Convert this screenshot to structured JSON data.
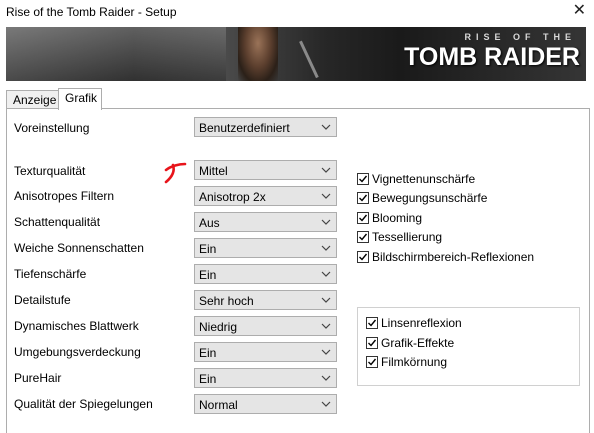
{
  "window": {
    "title": "Rise of the Tomb Raider - Setup",
    "close_glyph": "✕"
  },
  "banner": {
    "logo_line1": "RISE OF THE",
    "logo_line2": "TOMB RAIDER"
  },
  "tabs": [
    {
      "label": "Anzeige",
      "selected": false
    },
    {
      "label": "Grafik",
      "selected": true
    }
  ],
  "preset": {
    "label": "Voreinstellung",
    "value": "Benutzerdefiniert"
  },
  "settings": [
    {
      "label": "Texturqualität",
      "value": "Mittel"
    },
    {
      "label": "Anisotropes Filtern",
      "value": "Anisotrop 2x"
    },
    {
      "label": "Schattenqualität",
      "value": "Aus"
    },
    {
      "label": "Weiche Sonnenschatten",
      "value": "Ein"
    },
    {
      "label": "Tiefenschärfe",
      "value": "Ein"
    },
    {
      "label": "Detailstufe",
      "value": "Sehr hoch"
    },
    {
      "label": "Dynamisches Blattwerk",
      "value": "Niedrig"
    },
    {
      "label": "Umgebungsverdeckung",
      "value": "Ein"
    },
    {
      "label": "PureHair",
      "value": "Ein"
    },
    {
      "label": "Qualität der Spiegelungen",
      "value": "Normal"
    }
  ],
  "checkboxes": [
    {
      "label": "Vignettenunschärfe",
      "checked": true
    },
    {
      "label": "Bewegungsunschärfe",
      "checked": true
    },
    {
      "label": "Blooming",
      "checked": true
    },
    {
      "label": "Tessellierung",
      "checked": true
    },
    {
      "label": "Bildschirmbereich-Reflexionen",
      "checked": true
    }
  ],
  "group_checkboxes": [
    {
      "label": "Linsenreflexion",
      "checked": true
    },
    {
      "label": "Grafik-Effekte",
      "checked": true
    },
    {
      "label": "Filmkörnung",
      "checked": true
    }
  ],
  "colors": {
    "annotation_mark": "#e8141b",
    "banner_dark": "#1a1a1a"
  }
}
